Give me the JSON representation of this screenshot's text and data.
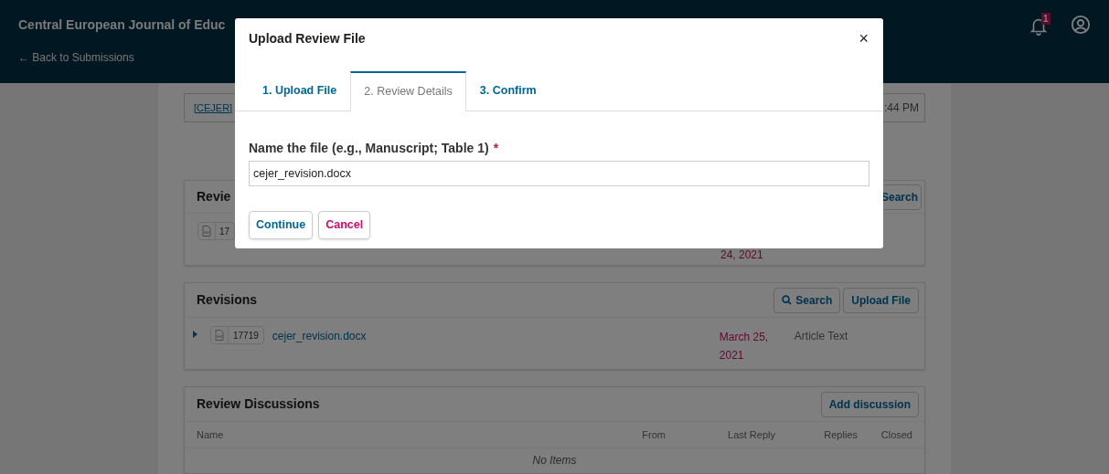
{
  "header": {
    "journal_title": "Central European Journal of Educ",
    "back_link": "← Back to Submissions",
    "notification_count": "1"
  },
  "summary": {
    "link": "[CEJER]",
    "time": ":44 PM"
  },
  "review_files": {
    "title": "Revie",
    "search_button": "Search",
    "row": {
      "id": "17",
      "date": "24, 2021"
    }
  },
  "revisions": {
    "title": "Revisions",
    "buttons": [
      {
        "kind": "search",
        "label": "Search"
      },
      {
        "kind": "plain",
        "label": "Upload File"
      }
    ],
    "rows": [
      {
        "expanded": false,
        "id": "17719",
        "name": "cejer_revision.docx",
        "date": "March 25, 2021",
        "type": "Article Text"
      }
    ]
  },
  "discussions": {
    "title": "Review Discussions",
    "button": "Add discussion",
    "columns": [
      "Name",
      "From",
      "Last Reply",
      "Replies",
      "Closed"
    ],
    "empty": "No Items"
  },
  "modal": {
    "title": "Upload Review File",
    "close": "×",
    "tabs": [
      {
        "label": "1. Upload File",
        "selected": false
      },
      {
        "label": "2. Review Details",
        "selected": true
      },
      {
        "label": "3. Confirm",
        "selected": false
      }
    ],
    "field": {
      "label": "Name the file (e.g., Manuscript; Table 1)",
      "required_mark": "*",
      "value": "cejer_revision.docx"
    },
    "buttons": [
      {
        "kind": "primary",
        "label": "Continue"
      },
      {
        "kind": "cancel",
        "label": "Cancel"
      }
    ]
  }
}
